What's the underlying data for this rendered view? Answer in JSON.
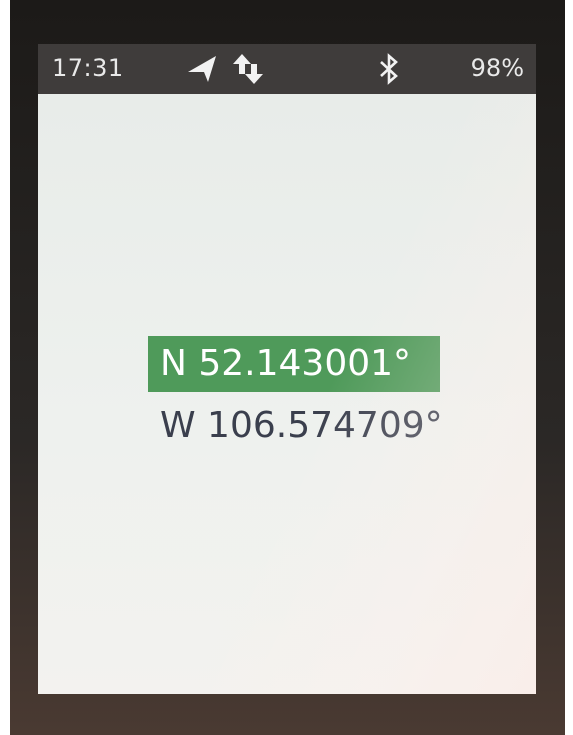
{
  "status_bar": {
    "time": "17:31",
    "battery": "98%",
    "icons": [
      "navigation-arrow-icon",
      "data-sync-icon",
      "bluetooth-icon"
    ]
  },
  "coordinates": {
    "latitude": "N 52.143001°",
    "longitude": "W 106.574709°"
  },
  "colors": {
    "status_bar_bg": "#3f3c3b",
    "highlight_green": "#4f9a5a",
    "screen_bg": "#eceee b",
    "text_dark": "#3a3f4d"
  }
}
